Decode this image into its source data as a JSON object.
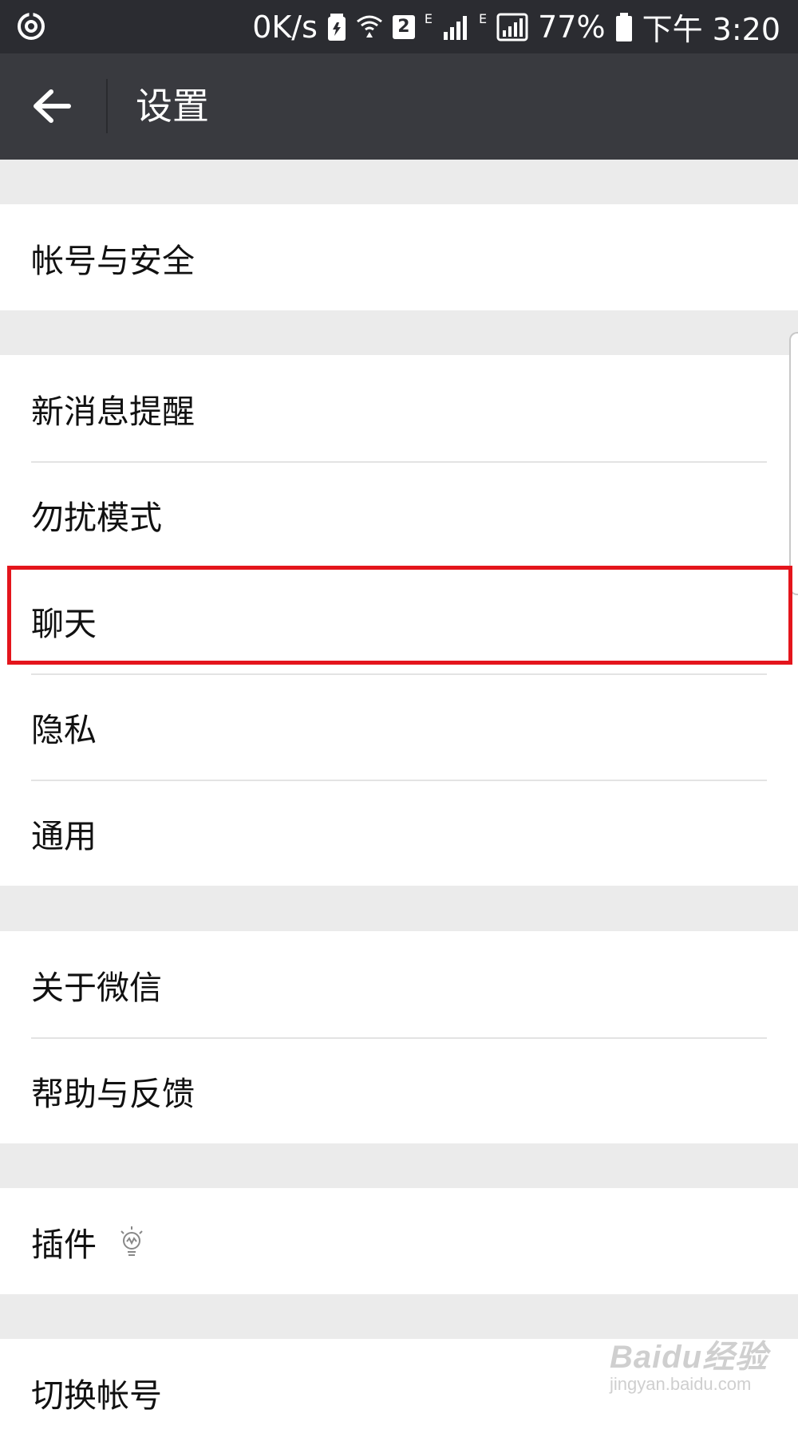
{
  "status_bar": {
    "speed": "0K/s",
    "sim_number": "2",
    "network_1": "E",
    "network_2": "E",
    "battery": "77%",
    "time": "下午 3:20",
    "left_icon": "app-status-icon",
    "icons": [
      "battery-saver-icon",
      "wifi-icon",
      "signal-icon",
      "signal-icon",
      "battery-icon"
    ]
  },
  "title_bar": {
    "back_icon": "back-arrow-icon",
    "title": "设置"
  },
  "groups": [
    {
      "items": [
        {
          "label": "帐号与安全"
        }
      ]
    },
    {
      "items": [
        {
          "label": "新消息提醒"
        },
        {
          "label": "勿扰模式"
        },
        {
          "label": "聊天"
        },
        {
          "label": "隐私"
        },
        {
          "label": "通用"
        }
      ]
    },
    {
      "items": [
        {
          "label": "关于微信"
        },
        {
          "label": "帮助与反馈"
        }
      ]
    },
    {
      "items": [
        {
          "label": "插件",
          "icon": "lightbulb-icon"
        }
      ]
    },
    {
      "items": [
        {
          "label": "切换帐号"
        }
      ]
    }
  ],
  "highlighted_item": "聊天",
  "watermark": {
    "main": "Baidu经验",
    "sub": "jingyan.baidu.com"
  },
  "colors": {
    "status_bar": "#2b2c31",
    "title_bar": "#393a3f",
    "background": "#ebebeb",
    "highlight": "#e4151c"
  }
}
